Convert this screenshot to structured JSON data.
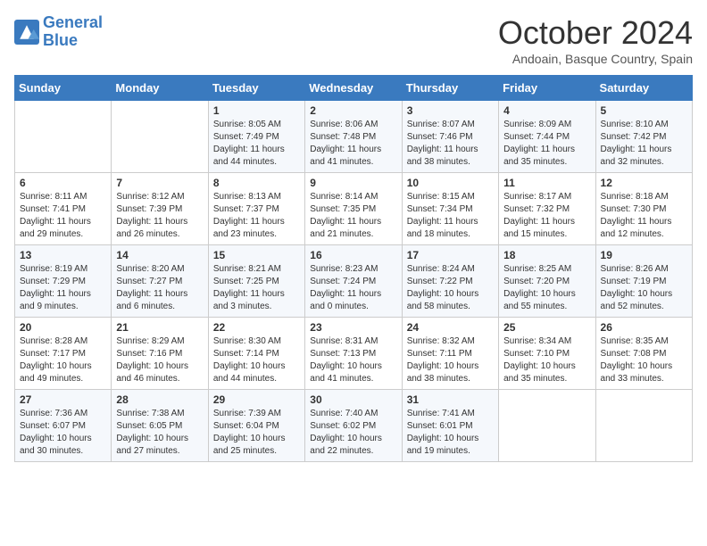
{
  "header": {
    "logo_line1": "General",
    "logo_line2": "Blue",
    "month": "October 2024",
    "location": "Andoain, Basque Country, Spain"
  },
  "weekdays": [
    "Sunday",
    "Monday",
    "Tuesday",
    "Wednesday",
    "Thursday",
    "Friday",
    "Saturday"
  ],
  "weeks": [
    [
      {
        "day": "",
        "content": ""
      },
      {
        "day": "",
        "content": ""
      },
      {
        "day": "1",
        "content": "Sunrise: 8:05 AM\nSunset: 7:49 PM\nDaylight: 11 hours and 44 minutes."
      },
      {
        "day": "2",
        "content": "Sunrise: 8:06 AM\nSunset: 7:48 PM\nDaylight: 11 hours and 41 minutes."
      },
      {
        "day": "3",
        "content": "Sunrise: 8:07 AM\nSunset: 7:46 PM\nDaylight: 11 hours and 38 minutes."
      },
      {
        "day": "4",
        "content": "Sunrise: 8:09 AM\nSunset: 7:44 PM\nDaylight: 11 hours and 35 minutes."
      },
      {
        "day": "5",
        "content": "Sunrise: 8:10 AM\nSunset: 7:42 PM\nDaylight: 11 hours and 32 minutes."
      }
    ],
    [
      {
        "day": "6",
        "content": "Sunrise: 8:11 AM\nSunset: 7:41 PM\nDaylight: 11 hours and 29 minutes."
      },
      {
        "day": "7",
        "content": "Sunrise: 8:12 AM\nSunset: 7:39 PM\nDaylight: 11 hours and 26 minutes."
      },
      {
        "day": "8",
        "content": "Sunrise: 8:13 AM\nSunset: 7:37 PM\nDaylight: 11 hours and 23 minutes."
      },
      {
        "day": "9",
        "content": "Sunrise: 8:14 AM\nSunset: 7:35 PM\nDaylight: 11 hours and 21 minutes."
      },
      {
        "day": "10",
        "content": "Sunrise: 8:15 AM\nSunset: 7:34 PM\nDaylight: 11 hours and 18 minutes."
      },
      {
        "day": "11",
        "content": "Sunrise: 8:17 AM\nSunset: 7:32 PM\nDaylight: 11 hours and 15 minutes."
      },
      {
        "day": "12",
        "content": "Sunrise: 8:18 AM\nSunset: 7:30 PM\nDaylight: 11 hours and 12 minutes."
      }
    ],
    [
      {
        "day": "13",
        "content": "Sunrise: 8:19 AM\nSunset: 7:29 PM\nDaylight: 11 hours and 9 minutes."
      },
      {
        "day": "14",
        "content": "Sunrise: 8:20 AM\nSunset: 7:27 PM\nDaylight: 11 hours and 6 minutes."
      },
      {
        "day": "15",
        "content": "Sunrise: 8:21 AM\nSunset: 7:25 PM\nDaylight: 11 hours and 3 minutes."
      },
      {
        "day": "16",
        "content": "Sunrise: 8:23 AM\nSunset: 7:24 PM\nDaylight: 11 hours and 0 minutes."
      },
      {
        "day": "17",
        "content": "Sunrise: 8:24 AM\nSunset: 7:22 PM\nDaylight: 10 hours and 58 minutes."
      },
      {
        "day": "18",
        "content": "Sunrise: 8:25 AM\nSunset: 7:20 PM\nDaylight: 10 hours and 55 minutes."
      },
      {
        "day": "19",
        "content": "Sunrise: 8:26 AM\nSunset: 7:19 PM\nDaylight: 10 hours and 52 minutes."
      }
    ],
    [
      {
        "day": "20",
        "content": "Sunrise: 8:28 AM\nSunset: 7:17 PM\nDaylight: 10 hours and 49 minutes."
      },
      {
        "day": "21",
        "content": "Sunrise: 8:29 AM\nSunset: 7:16 PM\nDaylight: 10 hours and 46 minutes."
      },
      {
        "day": "22",
        "content": "Sunrise: 8:30 AM\nSunset: 7:14 PM\nDaylight: 10 hours and 44 minutes."
      },
      {
        "day": "23",
        "content": "Sunrise: 8:31 AM\nSunset: 7:13 PM\nDaylight: 10 hours and 41 minutes."
      },
      {
        "day": "24",
        "content": "Sunrise: 8:32 AM\nSunset: 7:11 PM\nDaylight: 10 hours and 38 minutes."
      },
      {
        "day": "25",
        "content": "Sunrise: 8:34 AM\nSunset: 7:10 PM\nDaylight: 10 hours and 35 minutes."
      },
      {
        "day": "26",
        "content": "Sunrise: 8:35 AM\nSunset: 7:08 PM\nDaylight: 10 hours and 33 minutes."
      }
    ],
    [
      {
        "day": "27",
        "content": "Sunrise: 7:36 AM\nSunset: 6:07 PM\nDaylight: 10 hours and 30 minutes."
      },
      {
        "day": "28",
        "content": "Sunrise: 7:38 AM\nSunset: 6:05 PM\nDaylight: 10 hours and 27 minutes."
      },
      {
        "day": "29",
        "content": "Sunrise: 7:39 AM\nSunset: 6:04 PM\nDaylight: 10 hours and 25 minutes."
      },
      {
        "day": "30",
        "content": "Sunrise: 7:40 AM\nSunset: 6:02 PM\nDaylight: 10 hours and 22 minutes."
      },
      {
        "day": "31",
        "content": "Sunrise: 7:41 AM\nSunset: 6:01 PM\nDaylight: 10 hours and 19 minutes."
      },
      {
        "day": "",
        "content": ""
      },
      {
        "day": "",
        "content": ""
      }
    ]
  ]
}
